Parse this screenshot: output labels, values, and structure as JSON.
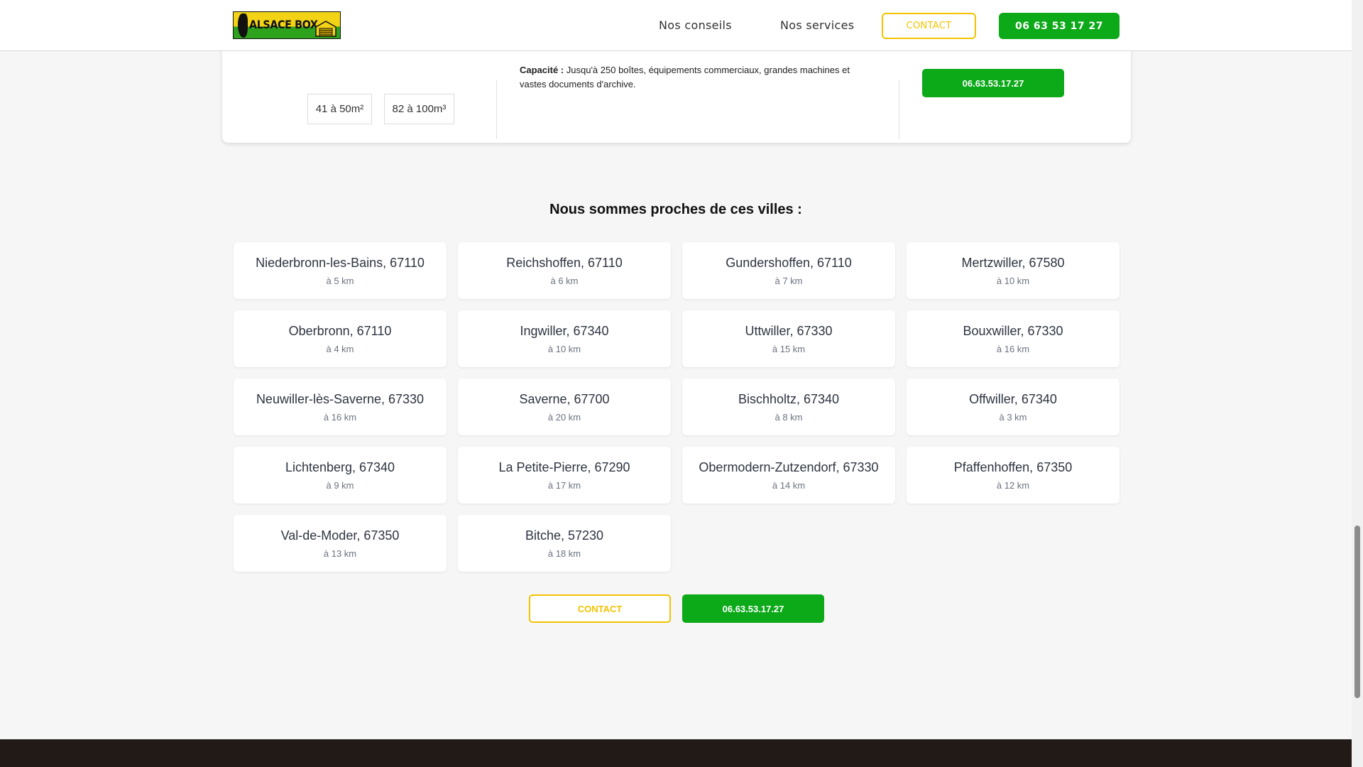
{
  "header": {
    "logo_text": "ALSACE BOX",
    "nav": [
      "Nos conseils",
      "Nos services"
    ],
    "contact_label": "CONTACT",
    "phone_label": "06 63 53 17 27"
  },
  "top_card": {
    "sizes": [
      "41 à 50m²",
      "82 à 100m³"
    ],
    "capacity_label": "Capacité :",
    "capacity_text": " Jusqu'à 250 boîtes, équipements commerciaux, grandes machines et vastes documents d'archive.",
    "phone_label": "06.63.53.17.27"
  },
  "cities_section": {
    "title": "Nous sommes proches de ces villes :",
    "cities": [
      {
        "name": "Niederbronn-les-Bains, 67110",
        "distance": "à 5 km"
      },
      {
        "name": "Reichshoffen, 67110",
        "distance": "à 6 km"
      },
      {
        "name": "Gundershoffen, 67110",
        "distance": "à 7 km"
      },
      {
        "name": "Mertzwiller, 67580",
        "distance": "à 10 km"
      },
      {
        "name": "Oberbronn, 67110",
        "distance": "à 4 km"
      },
      {
        "name": "Ingwiller, 67340",
        "distance": "à 10 km"
      },
      {
        "name": "Uttwiller, 67330",
        "distance": "à 15 km"
      },
      {
        "name": "Bouxwiller, 67330",
        "distance": "à 16 km"
      },
      {
        "name": "Neuwiller-lès-Saverne, 67330",
        "distance": "à 16 km"
      },
      {
        "name": "Saverne, 67700",
        "distance": "à 20 km"
      },
      {
        "name": "Bischholtz, 67340",
        "distance": "à 8 km"
      },
      {
        "name": "Offwiller, 67340",
        "distance": "à 3 km"
      },
      {
        "name": "Lichtenberg, 67340",
        "distance": "à 9 km"
      },
      {
        "name": "La Petite-Pierre, 67290",
        "distance": "à 17 km"
      },
      {
        "name": "Obermodern-Zutzendorf, 67330",
        "distance": "à 14 km"
      },
      {
        "name": "Pfaffenhoffen, 67350",
        "distance": "à 12 km"
      },
      {
        "name": "Val-de-Moder, 67350",
        "distance": "à 13 km"
      },
      {
        "name": "Bitche, 57230",
        "distance": "à 18 km"
      }
    ],
    "contact_label": "CONTACT",
    "phone_label": "06.63.53.17.27"
  },
  "colors": {
    "accent_green": "#0ca919",
    "accent_yellow": "#f3c300",
    "footer_bg": "#211a17"
  }
}
